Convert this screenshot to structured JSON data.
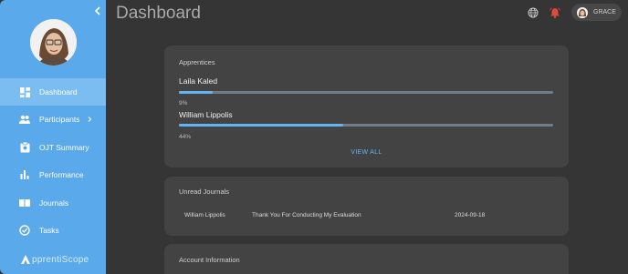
{
  "header": {
    "title": "Dashboard",
    "user_name": "GRACE"
  },
  "sidebar": {
    "items": [
      {
        "label": "Dashboard",
        "icon": "dashboard-icon",
        "active": true
      },
      {
        "label": "Participants",
        "icon": "people-icon",
        "has_submenu": true
      },
      {
        "label": "OJT Summary",
        "icon": "clipboard-icon"
      },
      {
        "label": "Performance",
        "icon": "bar-chart-icon"
      },
      {
        "label": "Journals",
        "icon": "book-icon"
      },
      {
        "label": "Tasks",
        "icon": "check-circle-icon"
      }
    ],
    "brand": "pprentiScope"
  },
  "apprentices": {
    "title": "Apprentices",
    "list": [
      {
        "name": "Laila Kaled",
        "progress_label": "9%",
        "progress": 0.09
      },
      {
        "name": "William Lippolis",
        "progress_label": "44%",
        "progress": 0.44
      }
    ],
    "view_all": "VIEW ALL"
  },
  "journals": {
    "title": "Unread Journals",
    "rows": [
      {
        "name": "William Lippolis",
        "subject": "Thank You For Conducting My Evaluation",
        "date": "2024-09-18"
      }
    ]
  },
  "account": {
    "title": "Account Information"
  },
  "colors": {
    "sidebar": "#5aa9ea",
    "accent": "#67b3f0",
    "bell": "#e0473d",
    "card": "#434343",
    "background": "#353535"
  }
}
